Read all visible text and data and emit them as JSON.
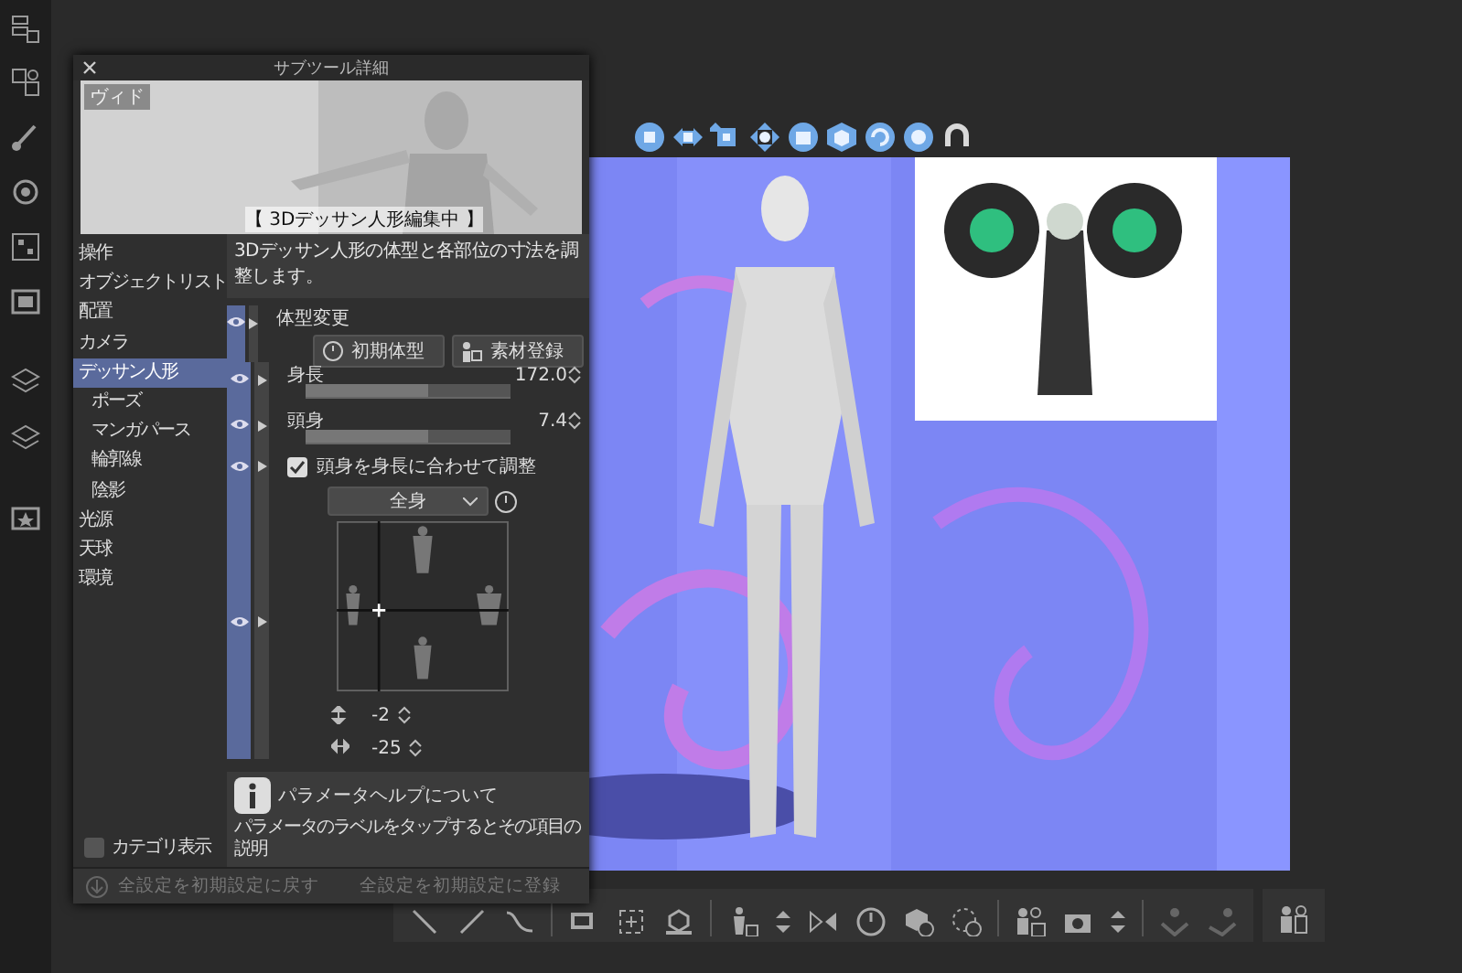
{
  "panel": {
    "title": "サブツール詳細",
    "preview": {
      "kind": "picture",
      "badge": "ヴィド",
      "caption": "【 3Dデッサン人形編集中 】"
    },
    "categories": [
      {
        "label": "操作",
        "selected": false
      },
      {
        "label": "オブジェクトリスト",
        "selected": false
      },
      {
        "label": "配置",
        "selected": false
      },
      {
        "label": "カメラ",
        "selected": false
      },
      {
        "label": "デッサン人形",
        "selected": true,
        "children": [
          {
            "label": "ポーズ",
            "selected": false
          },
          {
            "label": "マンガパース",
            "selected": false
          },
          {
            "label": "輪郭線",
            "selected": false
          },
          {
            "label": "陰影",
            "selected": false
          }
        ]
      },
      {
        "label": "光源",
        "selected": false
      },
      {
        "label": "天球",
        "selected": false
      },
      {
        "label": "環境",
        "selected": false
      }
    ],
    "description": "3Dデッサン人形の体型と各部位の寸法を調整します。",
    "properties": [
      {
        "kind": "group",
        "visible": true,
        "label": "体型変更",
        "buttons": [
          "初期体型",
          "素材登録"
        ]
      },
      {
        "kind": "slider",
        "visible": true,
        "label": "身長",
        "value": "172.0",
        "level": 0.6
      },
      {
        "kind": "slider",
        "visible": true,
        "label": "頭身",
        "value": "7.4",
        "level": 0.6
      },
      {
        "kind": "checkbox",
        "visible": true,
        "label": "頭身を身長に合わせて調整",
        "checked": true
      },
      {
        "kind": "bodypad",
        "visible": true,
        "dropdown": "全身",
        "vertical": "-2",
        "horizontal": "-25"
      }
    ],
    "help": {
      "title": "パラメータヘルプについて",
      "text": "パラメータのラベルをタップするとその項目の説明"
    },
    "category_toggle": {
      "label": "カテゴリ表示",
      "checked": false
    },
    "footer": [
      {
        "label": "全設定を初期設定に戻す",
        "disabled": true
      },
      {
        "label": "全設定を初期設定に登録",
        "disabled": true
      }
    ]
  }
}
